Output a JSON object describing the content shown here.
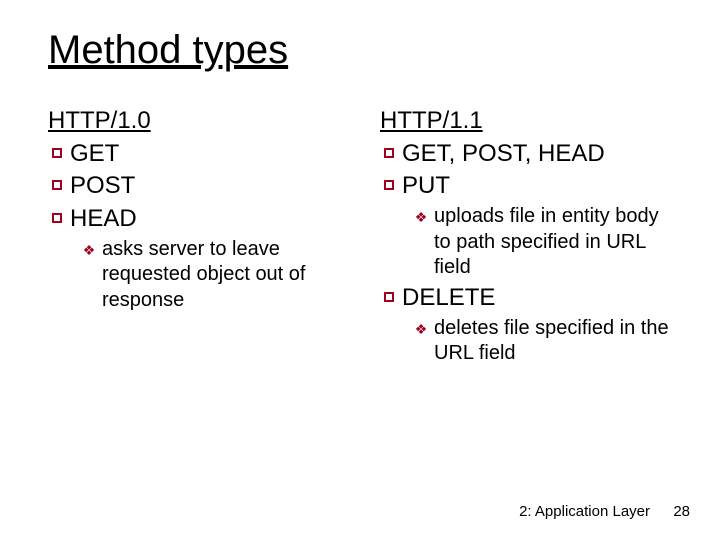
{
  "title": "Method types",
  "left": {
    "heading": "HTTP/1.0",
    "items": [
      {
        "label": "GET"
      },
      {
        "label": "POST"
      },
      {
        "label": "HEAD",
        "sub": [
          "asks server to leave requested object out of response"
        ]
      }
    ]
  },
  "right": {
    "heading": "HTTP/1.1",
    "items": [
      {
        "label": "GET, POST, HEAD"
      },
      {
        "label": "PUT",
        "sub": [
          "uploads file in entity body to path specified in URL field"
        ]
      },
      {
        "label": "DELETE",
        "sub": [
          "deletes file specified in the URL field"
        ]
      }
    ]
  },
  "footer": {
    "section": "2: Application Layer",
    "page": "28"
  }
}
